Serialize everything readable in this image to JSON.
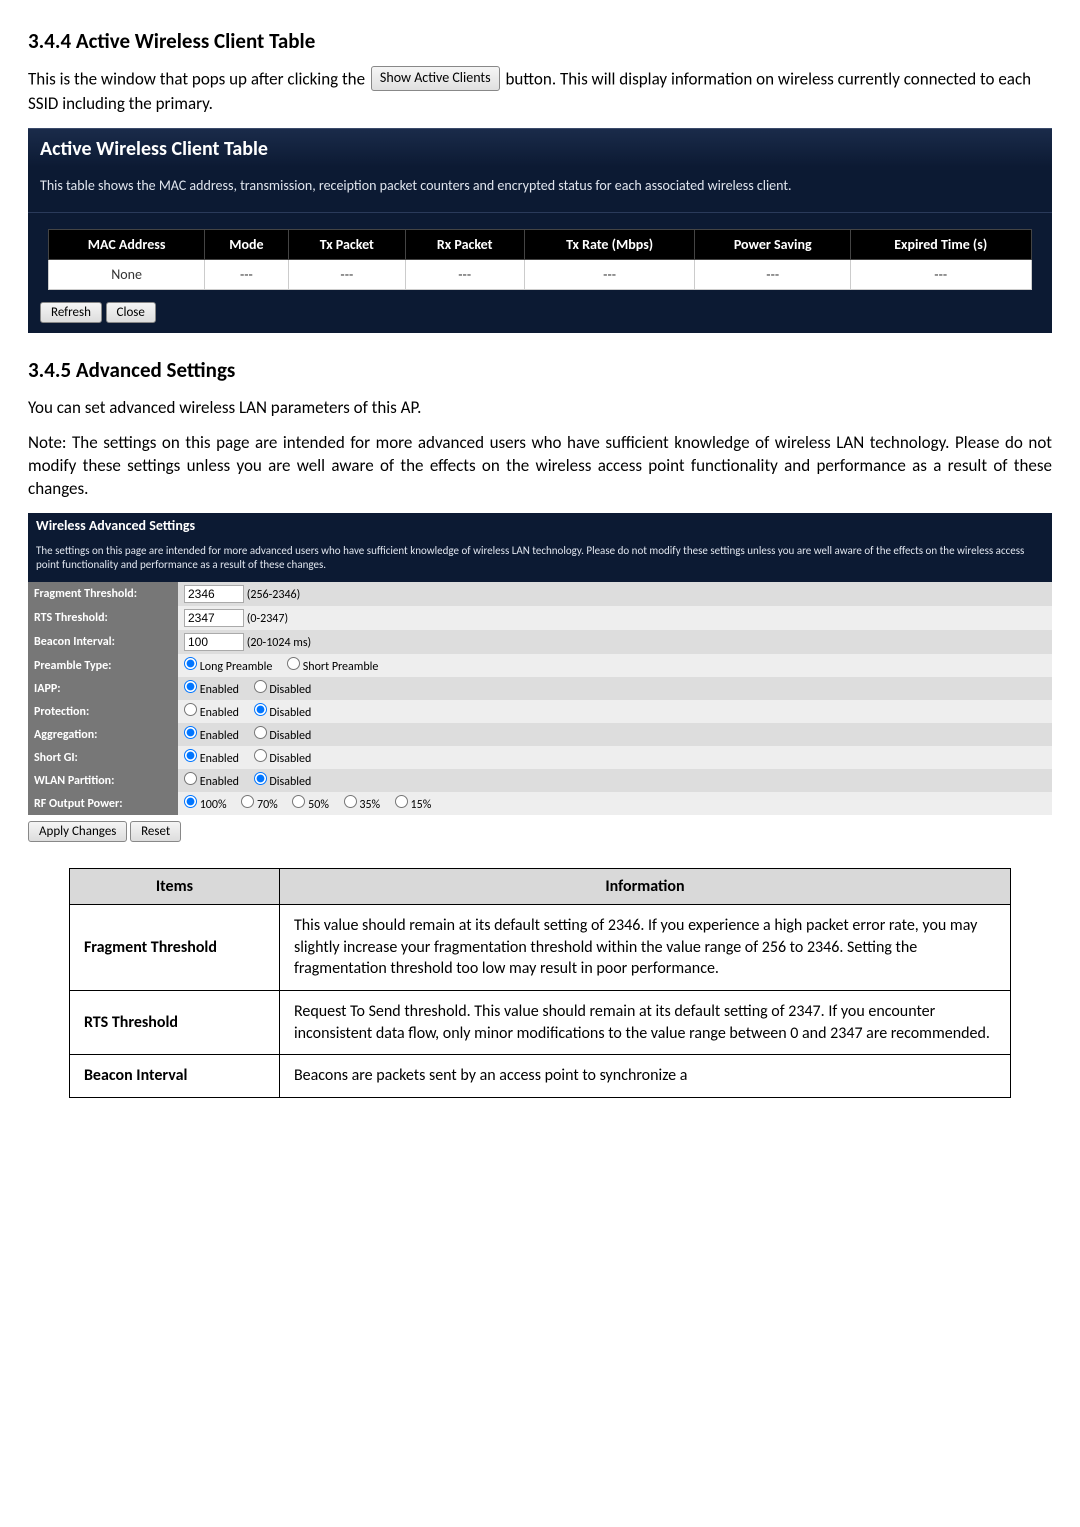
{
  "section1": {
    "heading": "3.4.4  Active Wireless Client Table",
    "para_pre": "This is the window that pops up after clicking the",
    "btn": "Show Active Clients",
    "para_post": "button. This will display information on wireless currently connected to each SSID including the primary.",
    "panel_title": "Active Wireless Client Table",
    "panel_desc": "This table shows the MAC address, transmission, receiption packet counters and encrypted status for each associated wireless client.",
    "headers": [
      "MAC Address",
      "Mode",
      "Tx Packet",
      "Rx Packet",
      "Tx Rate (Mbps)",
      "Power Saving",
      "Expired Time (s)"
    ],
    "row": [
      "None",
      "---",
      "---",
      "---",
      "---",
      "---",
      "---"
    ],
    "btn_refresh": "Refresh",
    "btn_close": "Close"
  },
  "section2": {
    "heading": "3.4.5  Advanced Settings",
    "para1": "You can set advanced wireless LAN parameters of this AP.",
    "para2": "Note: The settings on this page are intended for more advanced users who have sufficient knowledge of wireless LAN technology. Please do not modify these settings unless you are well aware of the effects on the wireless access point functionality and performance as a result of these changes.",
    "panel_title": "Wireless Advanced Settings",
    "panel_desc": "The settings on this page are intended for more advanced users who have sufficient knowledge of wireless LAN technology. Please do not modify these settings unless you are well aware of the effects on the wireless access point functionality and performance as a result of these changes.",
    "rows": {
      "frag": {
        "label": "Fragment Threshold:",
        "value": "2346",
        "range": "(256-2346)"
      },
      "rts": {
        "label": "RTS Threshold:",
        "value": "2347",
        "range": "(0-2347)"
      },
      "beacon": {
        "label": "Beacon Interval:",
        "value": "100",
        "range": "(20-1024 ms)"
      },
      "preamble": {
        "label": "Preamble Type:",
        "opt1": "Long Preamble",
        "opt2": "Short Preamble"
      },
      "iapp": {
        "label": "IAPP:",
        "opt1": "Enabled",
        "opt2": "Disabled"
      },
      "protection": {
        "label": "Protection:",
        "opt1": "Enabled",
        "opt2": "Disabled"
      },
      "aggregation": {
        "label": "Aggregation:",
        "opt1": "Enabled",
        "opt2": "Disabled"
      },
      "shortgi": {
        "label": "Short GI:",
        "opt1": "Enabled",
        "opt2": "Disabled"
      },
      "wlan": {
        "label": "WLAN Partition:",
        "opt1": "Enabled",
        "opt2": "Disabled"
      },
      "rf": {
        "label": "RF Output Power:",
        "opts": [
          "100%",
          "70%",
          "50%",
          "35%",
          "15%"
        ]
      }
    },
    "btn_apply": "Apply Changes",
    "btn_reset": "Reset"
  },
  "info_table": {
    "header_items": "Items",
    "header_info": "Information",
    "rows": [
      {
        "name": "Fragment Threshold",
        "desc": "This value should remain at its default setting of 2346. If you experience a high packet error rate, you may slightly increase your fragmentation threshold within the value range of 256 to 2346. Setting the fragmentation threshold too low may result in poor performance."
      },
      {
        "name": "RTS Threshold",
        "desc": "Request To Send threshold. This value should remain at its default setting of 2347. If you encounter inconsistent data flow, only minor modifications to the value range between 0 and 2347 are recommended."
      },
      {
        "name": "Beacon Interval",
        "desc": "Beacons are packets sent by an access point to synchronize a"
      }
    ]
  }
}
